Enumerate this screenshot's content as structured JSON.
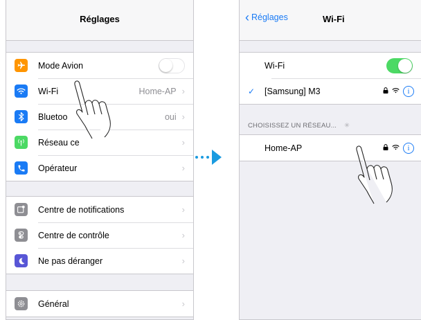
{
  "left": {
    "nav_title": "Réglages",
    "group1": [
      {
        "label": "Mode Avion",
        "icon": "airplane-icon",
        "color": "#ff9500",
        "toggle": "off"
      },
      {
        "label": "Wi-Fi",
        "icon": "wifi-icon",
        "color": "#1a7bf5",
        "value": "Home-AP"
      },
      {
        "label": "Bluetoo",
        "icon": "bluetooth-icon",
        "color": "#1a7bf5",
        "value": "oui"
      },
      {
        "label": "Réseau ce",
        "icon": "cellular-icon",
        "color": "#4cd964",
        "value": ""
      },
      {
        "label": "Opérateur",
        "icon": "phone-icon",
        "color": "#1a7bf5",
        "value": ""
      }
    ],
    "group2": [
      {
        "label": "Centre de notifications",
        "icon": "notifications-icon",
        "color": "#8e8e93"
      },
      {
        "label": "Centre de contrôle",
        "icon": "control-center-icon",
        "color": "#8e8e93"
      },
      {
        "label": "Ne pas déranger",
        "icon": "moon-icon",
        "color": "#5856d6"
      }
    ],
    "group3": [
      {
        "label": "Général",
        "icon": "gear-icon",
        "color": "#8e8e93"
      }
    ]
  },
  "right": {
    "back_label": "Réglages",
    "nav_title": "Wi-Fi",
    "wifi_label": "Wi-Fi",
    "wifi_toggle": "on",
    "connected_network": "[Samsung] M3",
    "section_header": "CHOISISSEZ UN RÉSEAU...",
    "network": "Home-AP",
    "info_glyph": "i"
  },
  "colors": {
    "accent": "#1a7bf5",
    "toggle_on": "#4cd964",
    "arrow": "#1a9be0"
  }
}
